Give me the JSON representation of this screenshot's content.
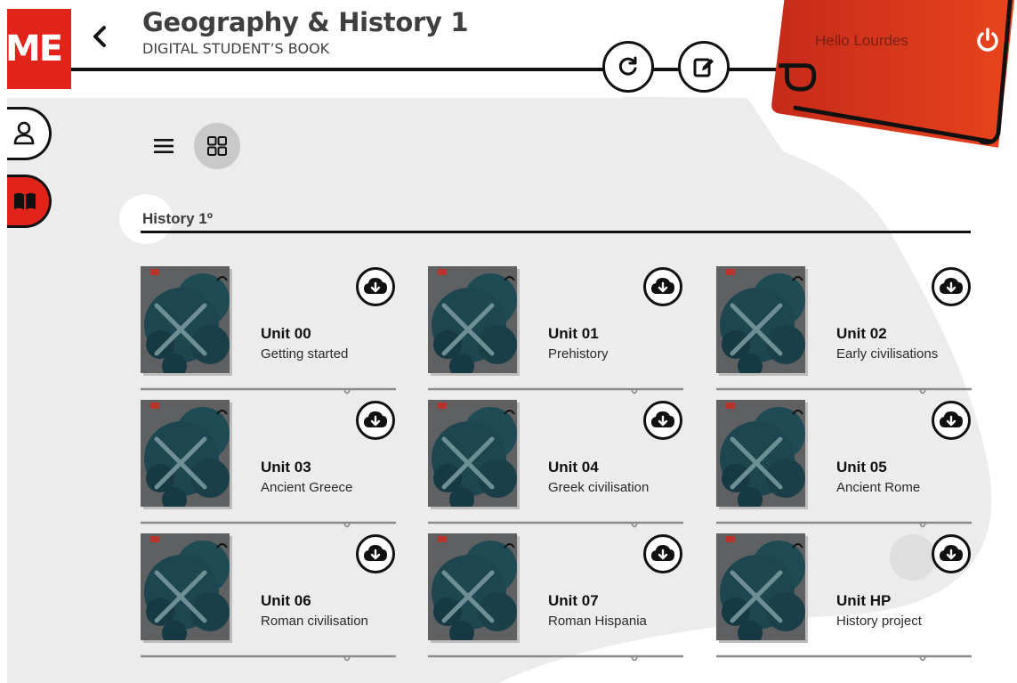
{
  "header": {
    "logo_text": "ME",
    "title": "Geography & History 1",
    "subtitle": "DIGITAL STUDENT’S BOOK",
    "greeting": "Hello Lourdes",
    "icons": {
      "back": "chevron-left-icon",
      "refresh": "refresh-icon",
      "edit": "edit-note-icon",
      "power": "power-icon"
    }
  },
  "sidebar": {
    "items": [
      {
        "icon": "user-icon",
        "active": false
      },
      {
        "icon": "book-icon",
        "active": true
      }
    ]
  },
  "view": {
    "list_icon": "list-view-icon",
    "grid_icon": "grid-view-icon",
    "selected": "grid"
  },
  "section": {
    "title": "History 1º"
  },
  "units": [
    {
      "title": "Unit 00",
      "subtitle": "Getting started"
    },
    {
      "title": "Unit 01",
      "subtitle": "Prehistory"
    },
    {
      "title": "Unit 02",
      "subtitle": "Early civilisations"
    },
    {
      "title": "Unit 03",
      "subtitle": "Ancient Greece"
    },
    {
      "title": "Unit 04",
      "subtitle": "Greek civilisation"
    },
    {
      "title": "Unit 05",
      "subtitle": "Ancient Rome"
    },
    {
      "title": "Unit 06",
      "subtitle": "Roman civilisation"
    },
    {
      "title": "Unit 07",
      "subtitle": "Roman Hispania"
    },
    {
      "title": "Unit HP",
      "subtitle": "History project"
    }
  ],
  "colors": {
    "brand_red": "#e2231a",
    "dark": "#111111",
    "background_blob": "#ececec",
    "cover_gray": "#5f6062",
    "cover_teal": "#1f4b55"
  }
}
